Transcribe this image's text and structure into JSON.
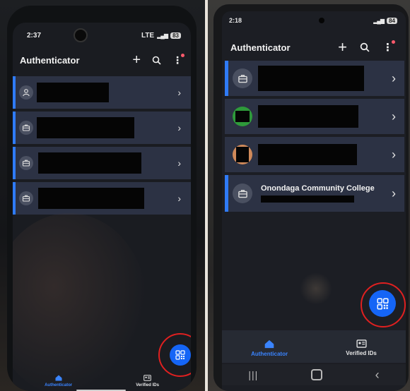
{
  "left_phone": {
    "status": {
      "time": "2:37",
      "network": "LTE",
      "battery": "83"
    },
    "app_title": "Authenticator",
    "accounts": [
      {
        "icon": "person-icon"
      },
      {
        "icon": "briefcase-icon"
      },
      {
        "icon": "briefcase-icon"
      },
      {
        "icon": "briefcase-icon"
      }
    ],
    "bottom_nav": {
      "authenticator_label": "Authenticator",
      "verified_ids_label": "Verified IDs"
    }
  },
  "right_phone": {
    "status": {
      "time": "2:18",
      "battery": "84"
    },
    "app_title": "Authenticator",
    "accounts": [
      {
        "icon": "briefcase-icon",
        "name": ""
      },
      {
        "icon": "green-avatar",
        "name": ""
      },
      {
        "icon": "orange-avatar",
        "name": ""
      },
      {
        "icon": "briefcase-icon",
        "name": "Onondaga Community College"
      }
    ],
    "bottom_nav": {
      "authenticator_label": "Authenticator",
      "verified_ids_label": "Verified IDs"
    }
  },
  "colors": {
    "accent": "#2f7bf6",
    "fab": "#1565f6",
    "row_bg": "#2c3244",
    "highlight_ring": "#e02020",
    "nav_active": "#3a84ff"
  }
}
